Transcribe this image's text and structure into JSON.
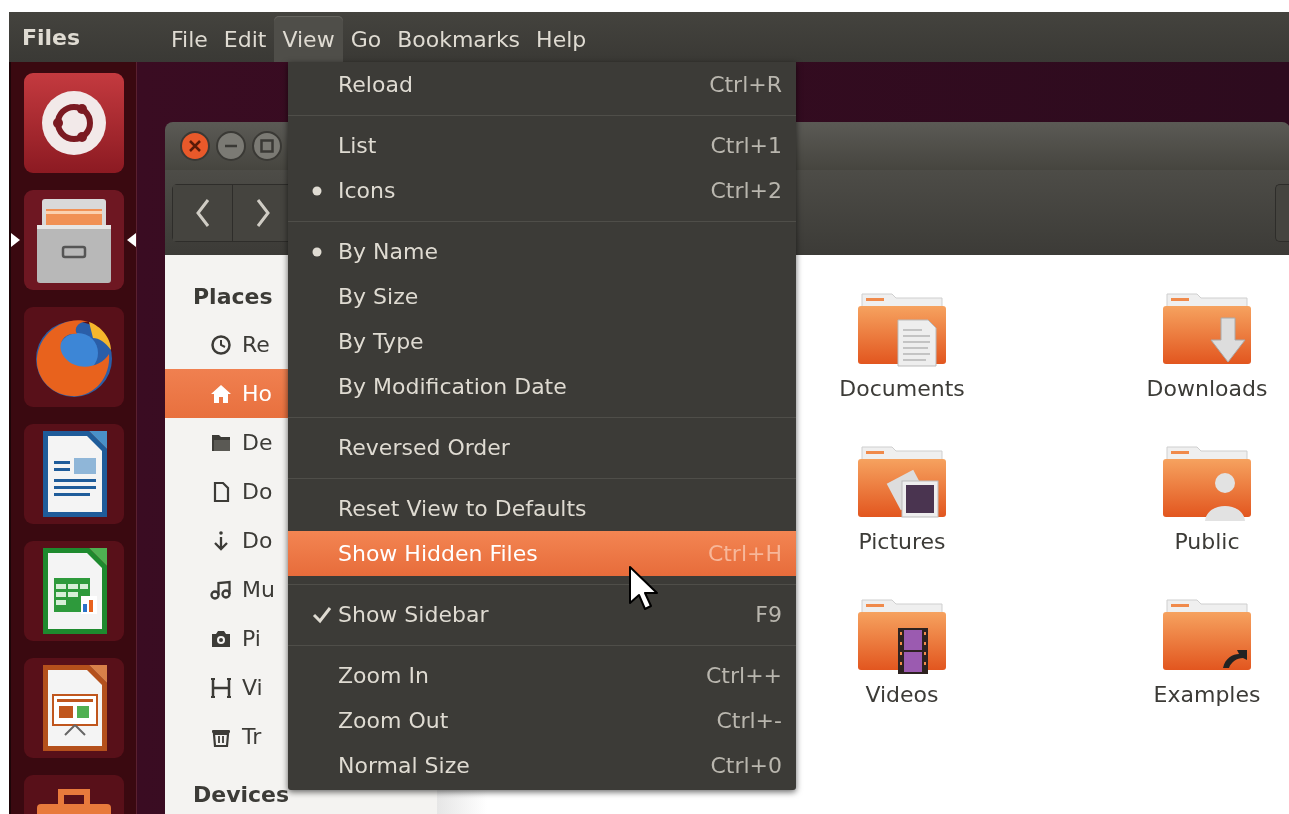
{
  "top_panel": {
    "app_name": "Files",
    "menus": [
      {
        "label": "File",
        "selected": false
      },
      {
        "label": "Edit",
        "selected": false
      },
      {
        "label": "View",
        "selected": true
      },
      {
        "label": "Go",
        "selected": false
      },
      {
        "label": "Bookmarks",
        "selected": false
      },
      {
        "label": "Help",
        "selected": false
      }
    ]
  },
  "launcher": [
    {
      "kind": "dash",
      "running": false
    },
    {
      "kind": "files",
      "running": true
    },
    {
      "kind": "browser",
      "running": false
    },
    {
      "kind": "writer",
      "running": false
    },
    {
      "kind": "calc",
      "running": false
    },
    {
      "kind": "impress",
      "running": false
    },
    {
      "kind": "store"
    }
  ],
  "window": {
    "sidebar": {
      "sections": [
        {
          "heading": "Places",
          "items": [
            {
              "label": "Re",
              "kind": "recent",
              "selected": false
            },
            {
              "label": "Ho",
              "kind": "home",
              "selected": true
            },
            {
              "label": "De",
              "kind": "folder",
              "selected": false
            },
            {
              "label": "Do",
              "kind": "document",
              "selected": false
            },
            {
              "label": "Do",
              "kind": "download",
              "selected": false
            },
            {
              "label": "Mu",
              "kind": "music",
              "selected": false
            },
            {
              "label": "Pi",
              "kind": "camera",
              "selected": false
            },
            {
              "label": "Vi",
              "kind": "film",
              "selected": false
            },
            {
              "label": "Tr",
              "kind": "trash",
              "selected": false
            }
          ]
        },
        {
          "heading": "Devices"
        }
      ]
    },
    "folders": [
      {
        "name": "Documents",
        "kind": "documents"
      },
      {
        "name": "Downloads",
        "kind": "downloads"
      },
      {
        "name": "Pictures",
        "kind": "pictures"
      },
      {
        "name": "Public",
        "kind": "public"
      },
      {
        "name": "Videos",
        "kind": "videos"
      },
      {
        "name": "Examples",
        "kind": "examples"
      }
    ]
  },
  "view_menu": {
    "sections": [
      {
        "items": [
          {
            "label": "Reload",
            "shortcut": "Ctrl+R",
            "kind": "action",
            "highlighted": false
          }
        ]
      },
      {
        "items": [
          {
            "label": "List",
            "shortcut": "Ctrl+1",
            "kind": "radio",
            "selected": false,
            "highlighted": false
          },
          {
            "label": "Icons",
            "shortcut": "Ctrl+2",
            "kind": "radio",
            "selected": true,
            "highlighted": false
          }
        ]
      },
      {
        "items": [
          {
            "label": "By Name",
            "kind": "radio",
            "selected": true,
            "highlighted": false
          },
          {
            "label": "By Size",
            "kind": "radio",
            "selected": false,
            "highlighted": false
          },
          {
            "label": "By Type",
            "kind": "radio",
            "selected": false,
            "highlighted": false
          },
          {
            "label": "By Modification Date",
            "kind": "radio",
            "selected": false,
            "highlighted": false
          }
        ]
      },
      {
        "items": [
          {
            "label": "Reversed Order",
            "kind": "check",
            "checked": false,
            "highlighted": false
          }
        ]
      },
      {
        "items": [
          {
            "label": "Reset View to Defaults",
            "kind": "action",
            "highlighted": false
          },
          {
            "label": "Show Hidden Files",
            "shortcut": "Ctrl+H",
            "kind": "check",
            "checked": false,
            "highlighted": true
          }
        ]
      },
      {
        "items": [
          {
            "label": "Show Sidebar",
            "shortcut": "F9",
            "kind": "check",
            "checked": true,
            "highlighted": false
          }
        ]
      },
      {
        "items": [
          {
            "label": "Zoom In",
            "shortcut": "Ctrl++",
            "kind": "action",
            "highlighted": false
          },
          {
            "label": "Zoom Out",
            "shortcut": "Ctrl+-",
            "kind": "action",
            "highlighted": false
          },
          {
            "label": "Normal Size",
            "shortcut": "Ctrl+0",
            "kind": "action",
            "highlighted": false
          }
        ]
      }
    ]
  }
}
